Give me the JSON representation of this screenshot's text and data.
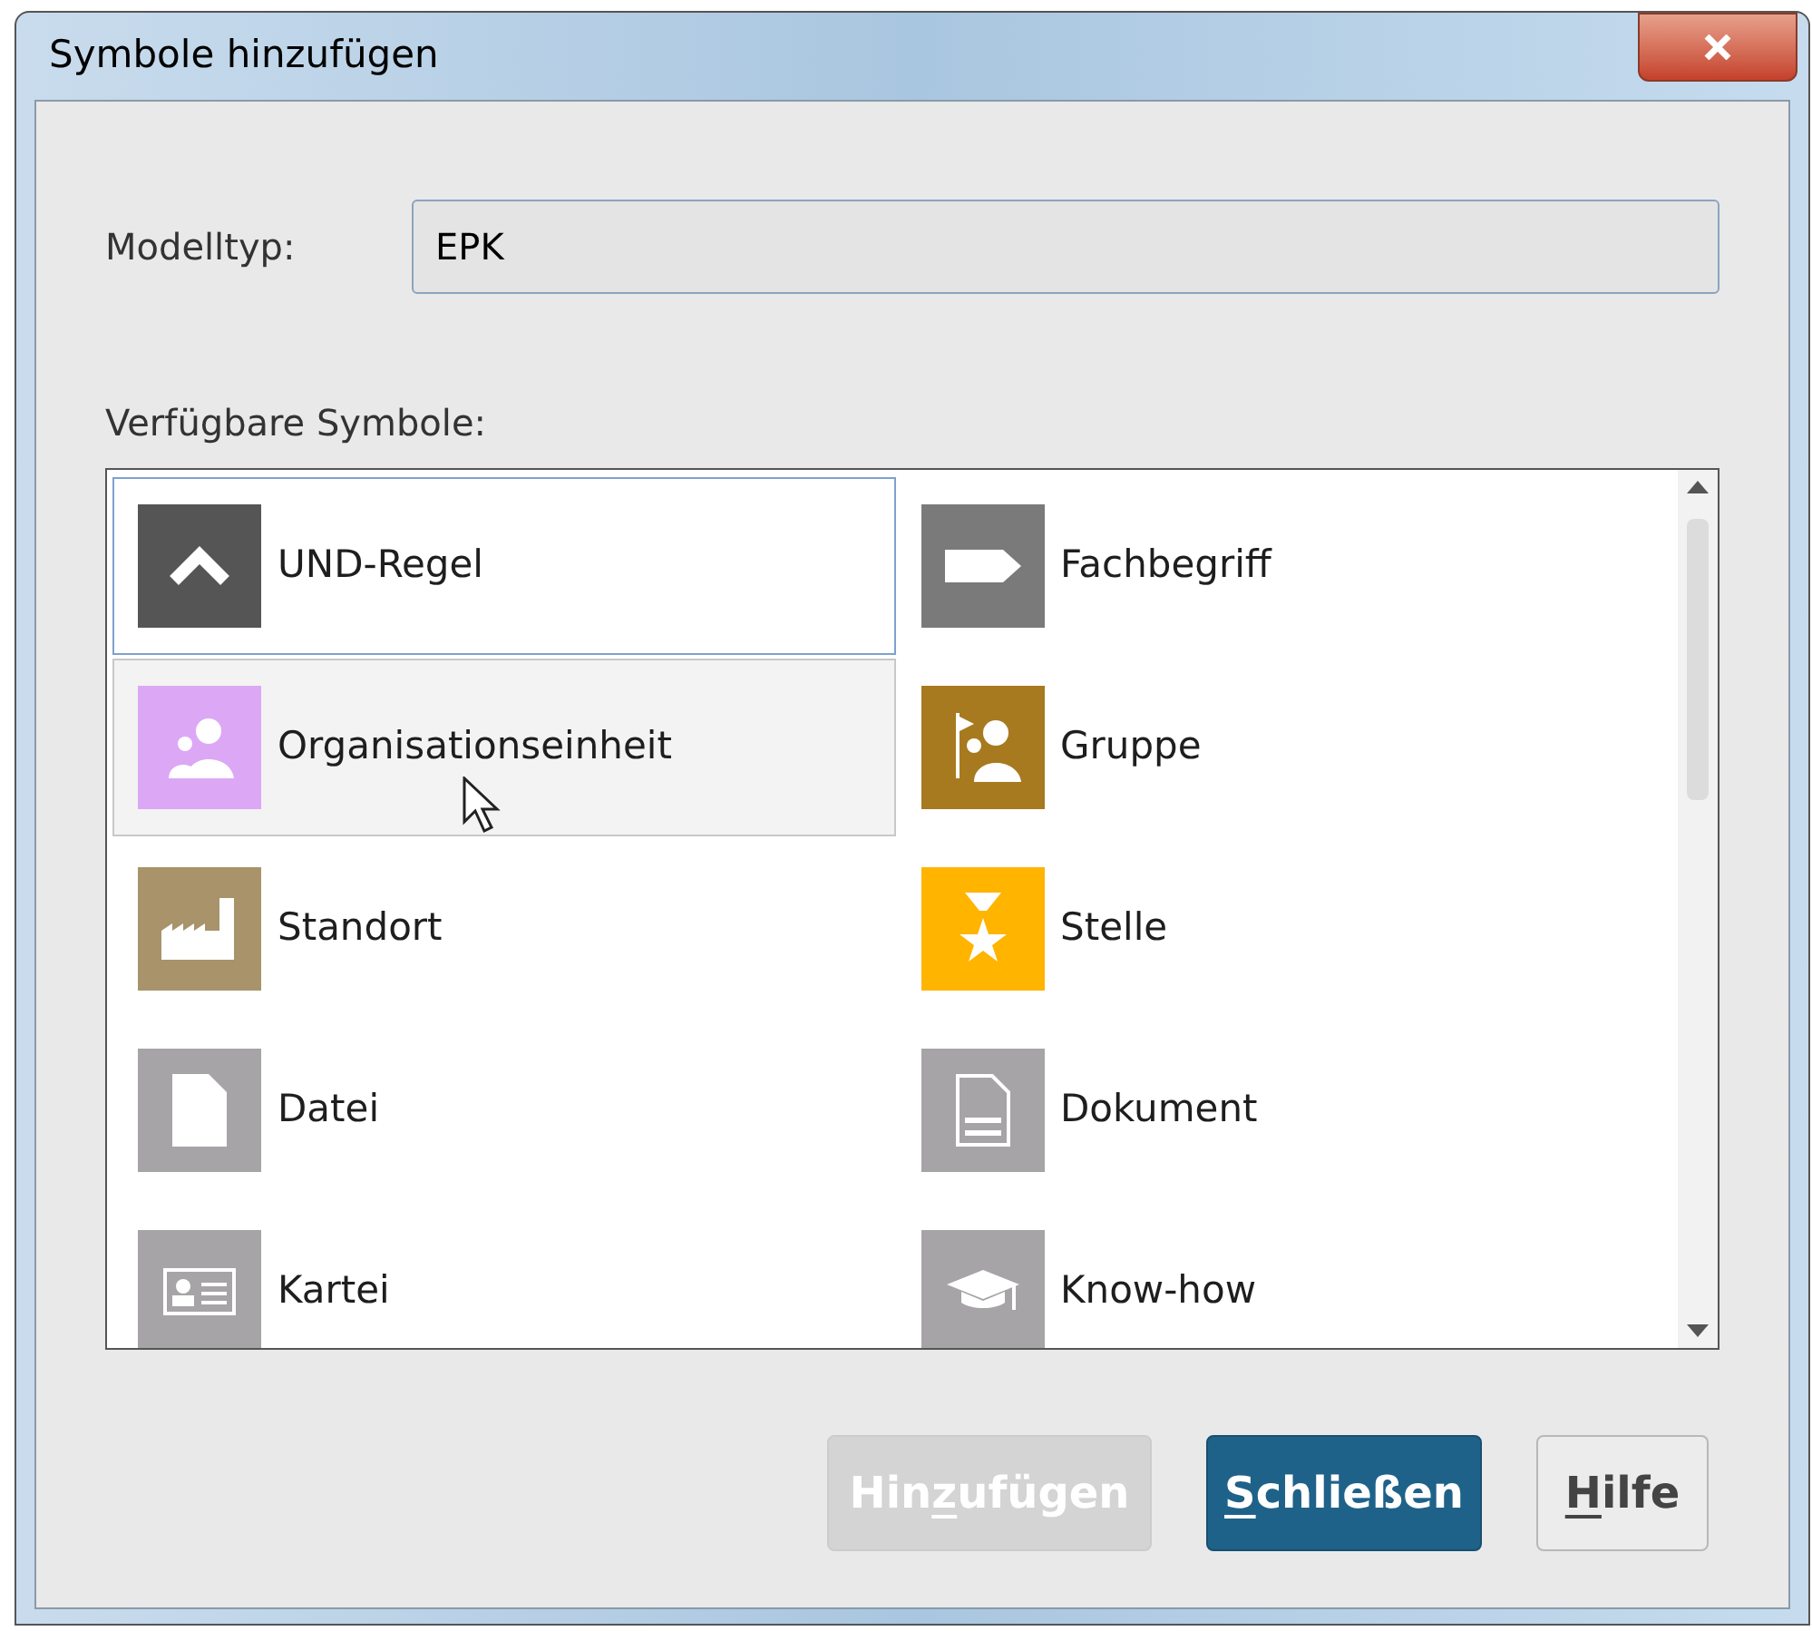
{
  "window": {
    "title": "Symbole hinzufügen"
  },
  "model_type": {
    "label": "Modelltyp:",
    "value": "EPK"
  },
  "symbols": {
    "label": "Verfügbare Symbole:",
    "items": [
      {
        "name": "UND-Regel",
        "kind": "and-rule",
        "color": "#555555",
        "selected": true,
        "hovered": false
      },
      {
        "name": "Fachbegriff",
        "kind": "tag",
        "color": "#7a7a7a",
        "selected": false,
        "hovered": false
      },
      {
        "name": "Organisationseinheit",
        "kind": "people",
        "color": "#dca8f5",
        "selected": false,
        "hovered": true
      },
      {
        "name": "Gruppe",
        "kind": "group",
        "color": "#a77a1f",
        "selected": false,
        "hovered": false
      },
      {
        "name": "Standort",
        "kind": "factory",
        "color": "#a8936a",
        "selected": false,
        "hovered": false
      },
      {
        "name": "Stelle",
        "kind": "position",
        "color": "#ffb400",
        "selected": false,
        "hovered": false
      },
      {
        "name": "Datei",
        "kind": "file",
        "color": "#a6a4a6",
        "selected": false,
        "hovered": false
      },
      {
        "name": "Dokument",
        "kind": "document",
        "color": "#a6a4a6",
        "selected": false,
        "hovered": false
      },
      {
        "name": "Kartei",
        "kind": "card",
        "color": "#a6a4a6",
        "selected": false,
        "hovered": false
      },
      {
        "name": "Know-how",
        "kind": "cap",
        "color": "#a6a4a6",
        "selected": false,
        "hovered": false
      }
    ]
  },
  "buttons": [
    {
      "before": "Hin",
      "mnemonic": "z",
      "after": "ufügen",
      "kind": "disabled"
    },
    {
      "mnemonic": "S",
      "after": "chließen",
      "kind": "primary"
    },
    {
      "mnemonic": "H",
      "after": "ilfe",
      "kind": "normal"
    }
  ]
}
